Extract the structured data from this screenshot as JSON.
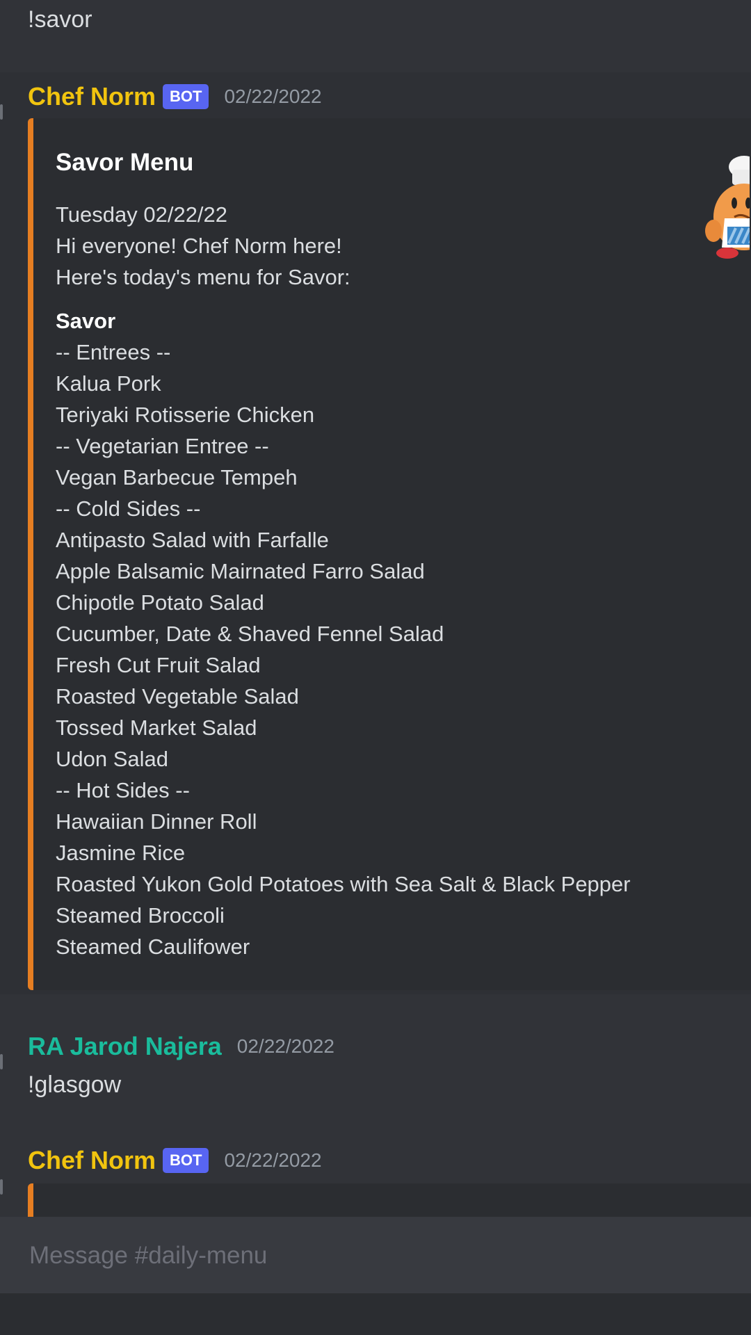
{
  "messages": [
    {
      "text": "!savor"
    },
    {
      "author": "Chef Norm",
      "author_color": "#f1c40f",
      "bot_tag": "BOT",
      "timestamp": "02/22/2022",
      "embed": {
        "accent_color": "#e67e22",
        "title": "Savor Menu",
        "description_lines": [
          "Tuesday 02/22/22",
          "Hi everyone! Chef Norm here!",
          "Here's today's menu for Savor:"
        ],
        "field_name": "Savor",
        "field_lines": [
          "-- Entrees --",
          "Kalua Pork",
          "Teriyaki Rotisserie Chicken",
          "-- Vegetarian Entree --",
          "Vegan Barbecue Tempeh",
          "-- Cold Sides --",
          "Antipasto Salad with Farfalle",
          "Apple Balsamic Mairnated Farro Salad",
          "Chipotle Potato Salad",
          "Cucumber, Date & Shaved Fennel Salad",
          "Fresh Cut Fruit Salad",
          "Roasted Vegetable Salad",
          "Tossed Market Salad",
          "Udon Salad",
          "-- Hot Sides --",
          "Hawaiian Dinner Roll",
          "Jasmine Rice",
          "Roasted Yukon Gold Potatoes with Sea Salt & Black Pepper",
          "Steamed Broccoli",
          "Steamed Caulifower"
        ],
        "thumbnail_icon": "chef-mascot-icon"
      }
    },
    {
      "author": "RA Jarod Najera",
      "author_color": "#1abc9c",
      "timestamp": "02/22/2022",
      "text": "!glasgow"
    },
    {
      "author": "Chef Norm",
      "author_color": "#f1c40f",
      "bot_tag": "BOT",
      "timestamp": "02/22/2022"
    }
  ],
  "composer": {
    "placeholder": "Message #daily-menu"
  }
}
